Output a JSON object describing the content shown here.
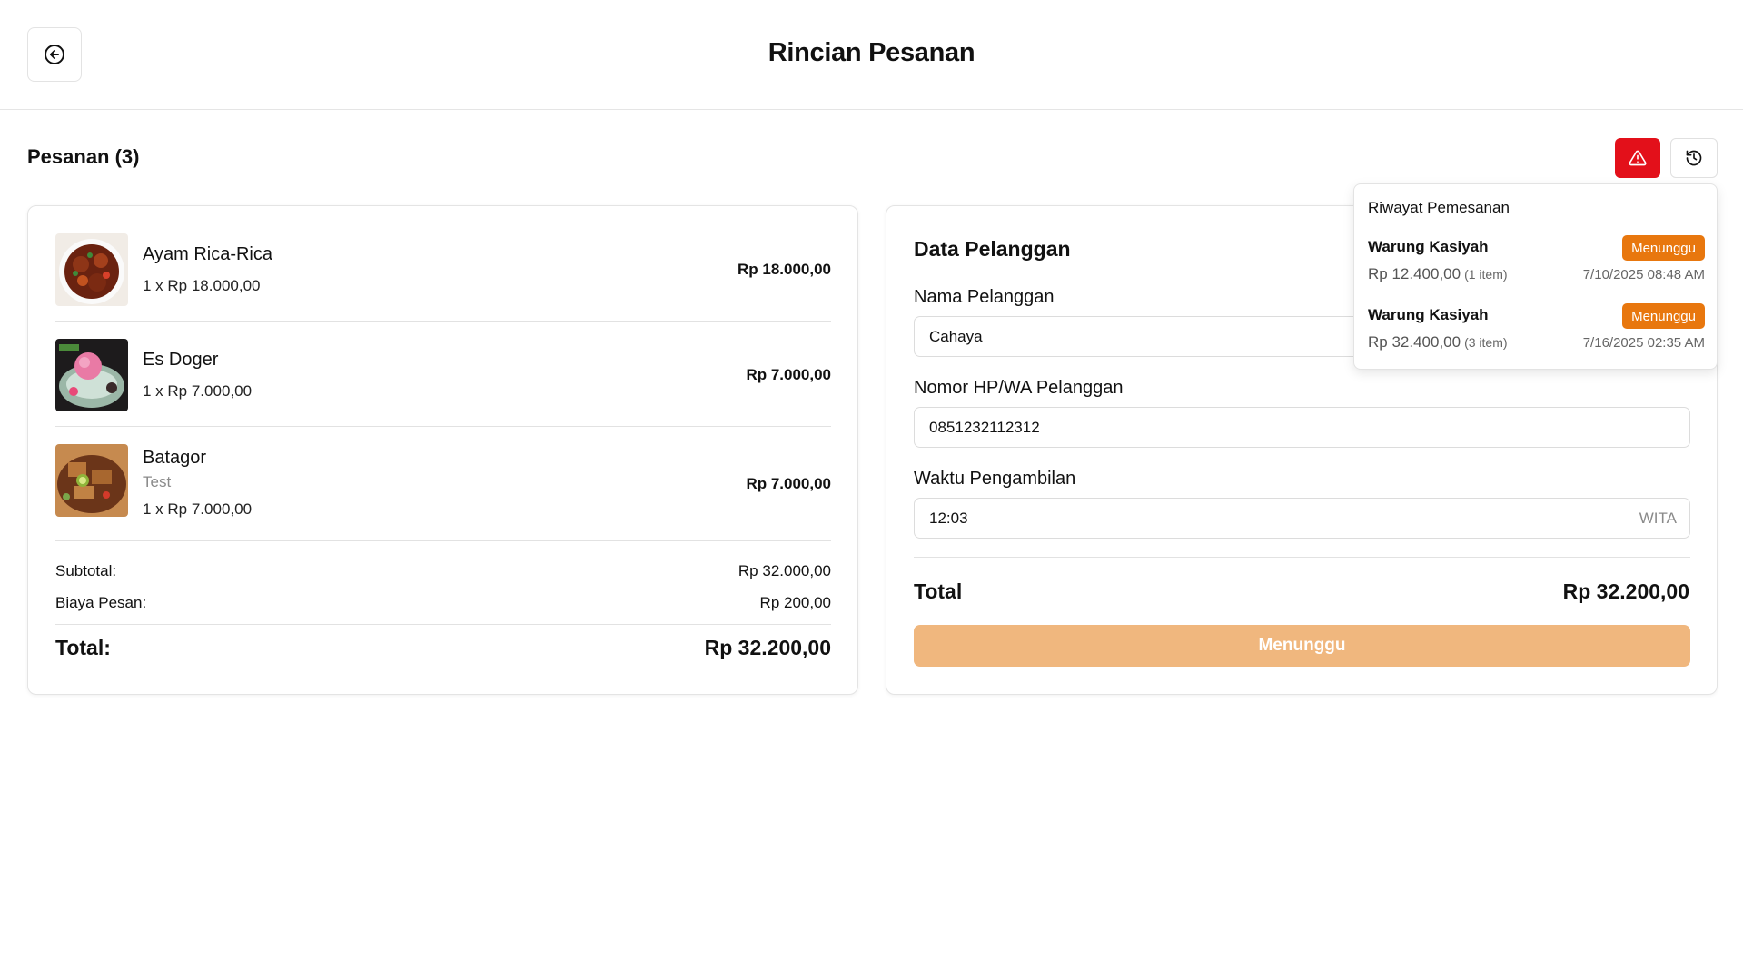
{
  "header": {
    "title": "Rincian Pesanan"
  },
  "orders": {
    "title": "Pesanan (3)",
    "items": [
      {
        "name": "Ayam Rica-Rica",
        "note": "",
        "qty": "1 x Rp 18.000,00",
        "price": "Rp 18.000,00"
      },
      {
        "name": "Es Doger",
        "note": "",
        "qty": "1 x Rp 7.000,00",
        "price": "Rp 7.000,00"
      },
      {
        "name": "Batagor",
        "note": "Test",
        "qty": "1 x Rp 7.000,00",
        "price": "Rp 7.000,00"
      }
    ],
    "subtotal_label": "Subtotal:",
    "subtotal_value": "Rp 32.000,00",
    "fee_label": "Biaya Pesan:",
    "fee_value": "Rp 200,00",
    "total_label": "Total:",
    "total_value": "Rp 32.200,00"
  },
  "customer": {
    "title": "Data Pelanggan",
    "name_label": "Nama Pelanggan",
    "name_value": "Cahaya",
    "phone_label": "Nomor HP/WA Pelanggan",
    "phone_value": "0851232112312",
    "time_label": "Waktu Pengambilan",
    "time_value": "12:03",
    "time_zone": "WITA",
    "total_label": "Total",
    "total_value": "Rp 32.200,00",
    "status_button": "Menunggu"
  },
  "history": {
    "title": "Riwayat Pemesanan",
    "entries": [
      {
        "store": "Warung Kasiyah",
        "status": "Menunggu",
        "amount": "Rp 12.400,00",
        "count": "(1 item)",
        "date": "7/10/2025 08:48 AM"
      },
      {
        "store": "Warung Kasiyah",
        "status": "Menunggu",
        "amount": "Rp 32.400,00",
        "count": "(3 item)",
        "date": "7/16/2025 02:35 AM"
      }
    ]
  },
  "colors": {
    "alert": "#e3101a",
    "badge": "#e8770e",
    "button_disabled": "#f0b77e"
  },
  "icons": {
    "back": "arrow-left-circle-icon",
    "alert": "warning-triangle-icon",
    "history": "history-clock-icon"
  }
}
